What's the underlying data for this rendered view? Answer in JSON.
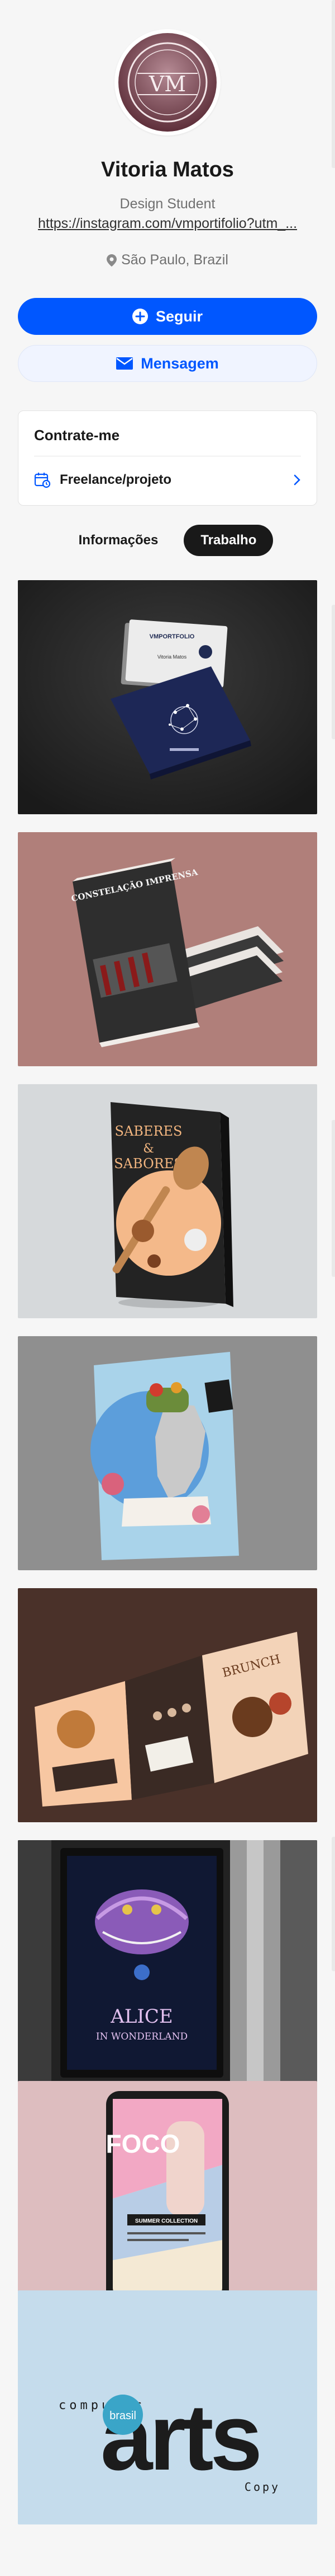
{
  "profile": {
    "avatar_text": "VM",
    "name": "Vitoria Matos",
    "occupation": "Design Student",
    "link": "https://instagram.com/vmportifolio?utm_...",
    "location": "São Paulo, Brazil"
  },
  "actions": {
    "follow": "Seguir",
    "message": "Mensagem"
  },
  "hire": {
    "title": "Contrate-me",
    "item": "Freelance/projeto"
  },
  "tabs": [
    {
      "label": "Informações",
      "active": false
    },
    {
      "label": "Trabalho",
      "active": true
    }
  ],
  "projects": {
    "card_title": "VMPORTFOLIO",
    "card_sub": "Vitoria Matos",
    "book_title": "CONSTELAÇÃO IMPRENSA",
    "sab_line1": "SABERES",
    "sab_amp": "&",
    "sab_line2": "SABORES",
    "brochure_title": "BRUNCH",
    "alice_line1": "ALICE",
    "alice_line2": "IN WONDERLAND",
    "foco_title": "FOCO",
    "foco_sub": "SUMMER COLLECTION",
    "ca_top": "computer",
    "ca_main": "arts",
    "ca_badge": "brasil",
    "ca_bottom": "Copy"
  },
  "colors": {
    "accent": "#0057ff",
    "accent_light": "#f0f4ff",
    "tab_active": "#191919"
  }
}
